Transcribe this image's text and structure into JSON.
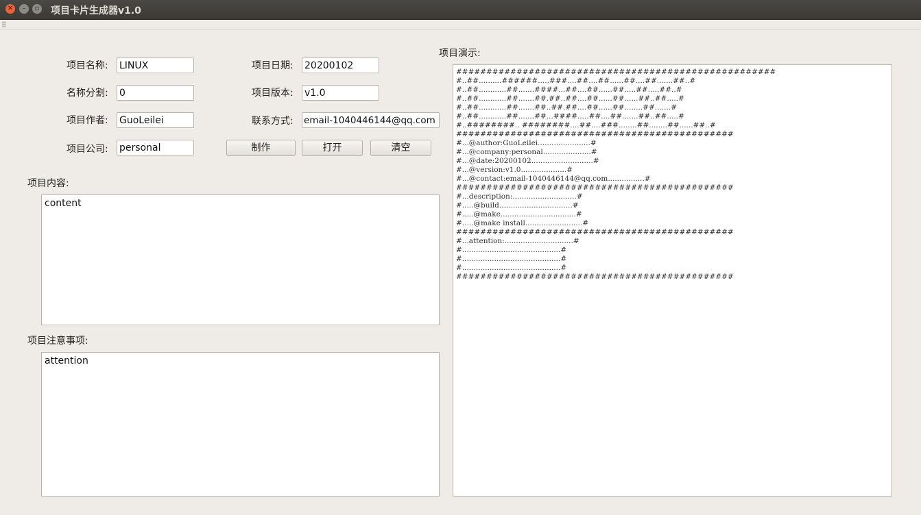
{
  "window": {
    "title": "项目卡片生成器v1.0",
    "close_glyph": "✕",
    "min_glyph": "–",
    "max_glyph": "▫"
  },
  "form": {
    "name_label": "项目名称:",
    "name_value": "LINUX",
    "split_label": "名称分割:",
    "split_value": "0",
    "author_label": "项目作者:",
    "author_value": "GuoLeilei",
    "company_label": "项目公司:",
    "company_value": "personal",
    "date_label": "项目日期:",
    "date_value": "20200102",
    "version_label": "项目版本:",
    "version_value": "v1.0",
    "contact_label": "联系方式:",
    "contact_value": "email-1040446144@qq.com"
  },
  "buttons": {
    "make": "制作",
    "open": "打开",
    "clear": "清空"
  },
  "content": {
    "label": "项目内容:",
    "value": "content"
  },
  "attention": {
    "label": "项目注意事项:",
    "value": "attention"
  },
  "preview": {
    "label": "项目演示:",
    "text": "#####################################################\n#..##..........######.....###....##....##......##....##.......##..#\n#..##............##.......####...##....##......##.....##.....##..#\n#..##............##.......##.##..##....##......##......##..##.....#\n#..##............##.......##..##.##....##......##........##.......#\n#..##............##.......##...####.....##....##.......##..##.....#\n#..########.. ########....##....###........##........##......##..#\n##############################################\n#...@author:GuoLeilei.......................#\n#...@company:personal.....................#\n#...@date:20200102...........................#\n#...@version:v1.0....................#\n#...@contact:email-1040446144@qq.com................#\n##############################################\n#...description:............................#\n#.....@build................................#\n#.....@make.................................#\n#.....@make install.........................#\n##############################################\n#...attention:..............................#\n#...........................................#\n#...........................................#\n#...........................................#\n##############################################"
  }
}
